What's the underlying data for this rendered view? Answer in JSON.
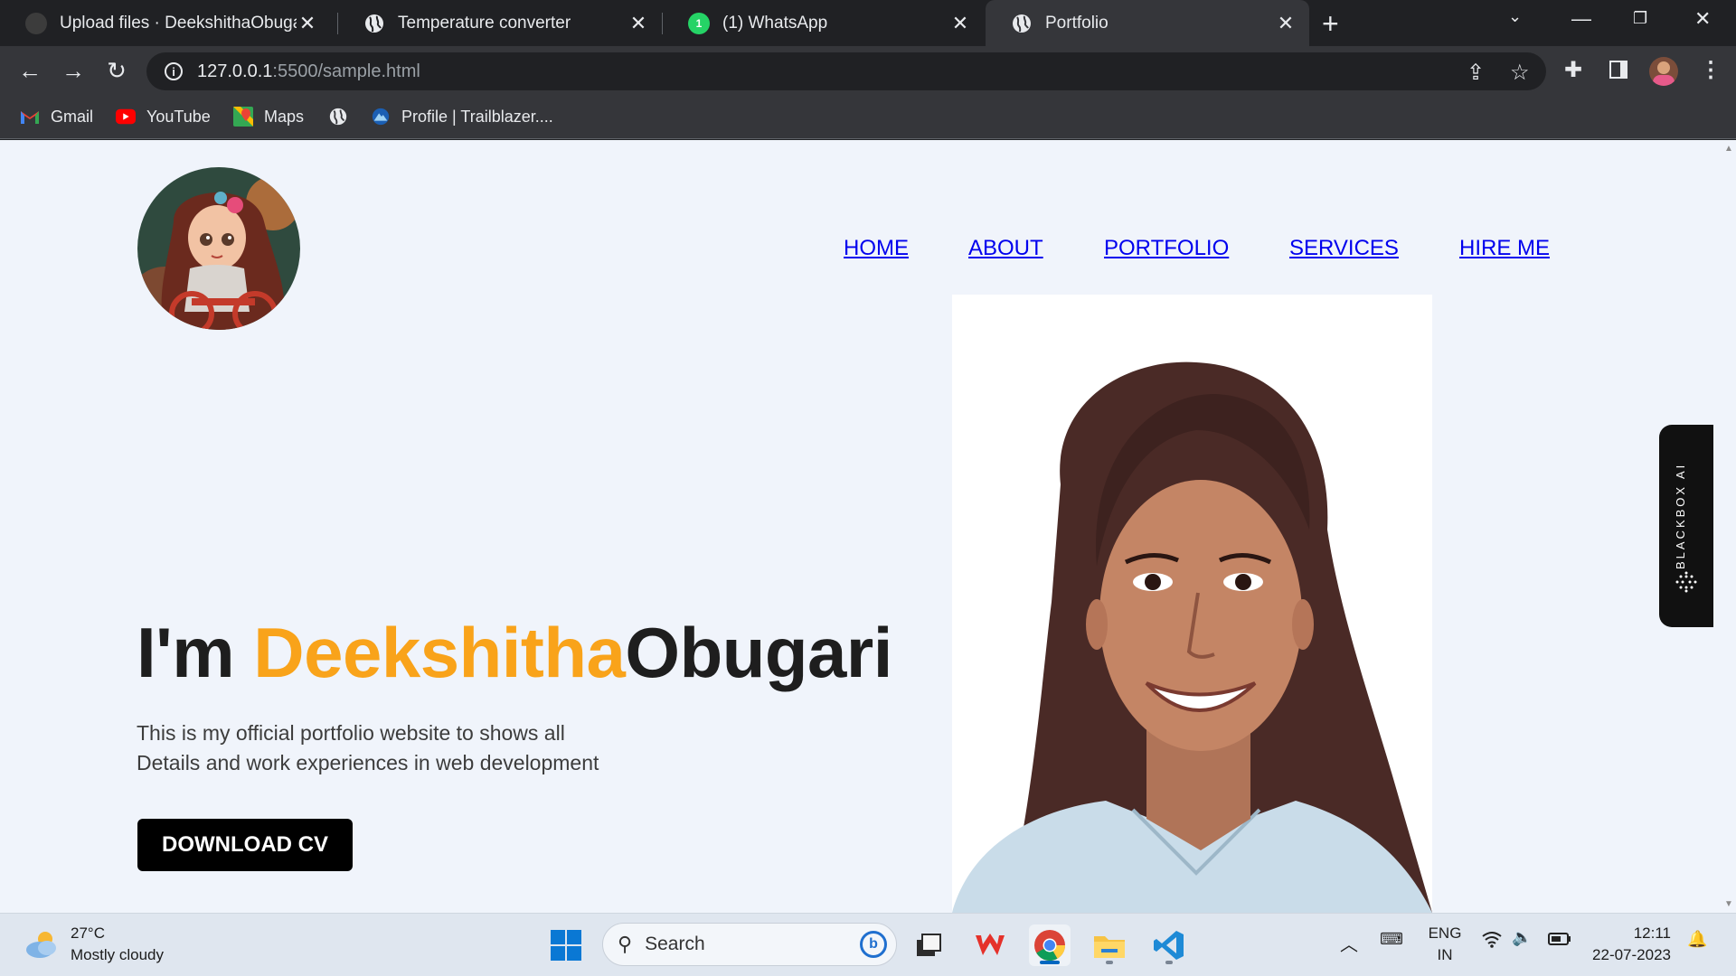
{
  "browser": {
    "tabs": [
      {
        "title": "Upload files · DeekshithaObugari",
        "close": "✕",
        "icon": "github-icon",
        "active": false
      },
      {
        "title": "Temperature converter",
        "close": "✕",
        "icon": "globe-icon",
        "active": false
      },
      {
        "title": "(1) WhatsApp",
        "close": "✕",
        "icon": "whatsapp-icon",
        "active": false
      },
      {
        "title": "Portfolio",
        "close": "✕",
        "icon": "globe-icon",
        "active": true
      }
    ],
    "new_tab": "+",
    "url_host": "127.0.0.1",
    "url_path": ":5500/sample.html",
    "bookmarks": [
      {
        "label": "Gmail",
        "icon": "gmail-icon"
      },
      {
        "label": "YouTube",
        "icon": "youtube-icon"
      },
      {
        "label": "Maps",
        "icon": "maps-icon"
      },
      {
        "label": "",
        "icon": "globe-icon"
      },
      {
        "label": "Profile | Trailblazer....",
        "icon": "trailblazer-icon"
      }
    ]
  },
  "page": {
    "nav": [
      "HOME",
      "ABOUT",
      "PORTFOLIO",
      "SERVICES",
      "HIRE ME"
    ],
    "hero": {
      "prefix": "I'm ",
      "first_name": "Deekshitha",
      "last_name": "Obugari",
      "line1": "This is my official portfolio website to shows all",
      "line2": "Details and work experiences in web development",
      "button": "DOWNLOAD CV"
    },
    "sidebar_widget": "BLACKBOX AI",
    "accent_color": "#f9a31a"
  },
  "taskbar": {
    "weather_temp": "27°C",
    "weather_desc": "Mostly cloudy",
    "search_placeholder": "Search",
    "lang_top": "ENG",
    "lang_bottom": "IN",
    "time": "12:11",
    "date": "22-07-2023"
  }
}
